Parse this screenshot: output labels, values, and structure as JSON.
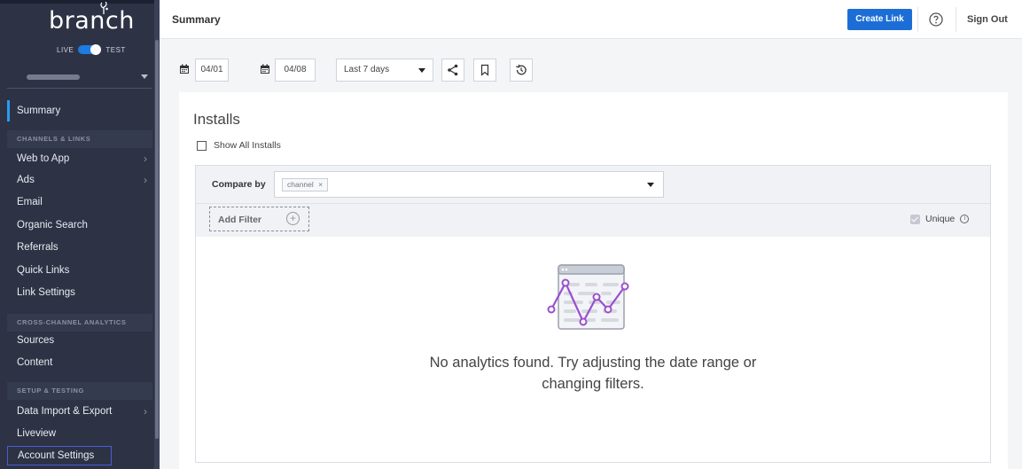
{
  "sidebar": {
    "logo": "branch",
    "env": {
      "live": "LIVE",
      "test": "TEST"
    },
    "summary": "Summary",
    "sections": {
      "channels": "CHANNELS & LINKS",
      "cross": "CROSS-CHANNEL ANALYTICS",
      "setup": "SETUP & TESTING"
    },
    "items": {
      "web_to_app": "Web to App",
      "ads": "Ads",
      "email": "Email",
      "organic_search": "Organic Search",
      "referrals": "Referrals",
      "quick_links": "Quick Links",
      "link_settings": "Link Settings",
      "sources": "Sources",
      "content": "Content",
      "data_import_export": "Data Import & Export",
      "liveview": "Liveview",
      "account_settings": "Account Settings"
    },
    "chevron": "›"
  },
  "header": {
    "title": "Summary",
    "create_link": "Create Link",
    "sign_out": "Sign Out"
  },
  "toolbar": {
    "start_date": "04/01",
    "end_date": "04/08",
    "range": "Last 7 days"
  },
  "main": {
    "heading": "Installs",
    "show_all": "Show All Installs",
    "compare_by": "Compare by",
    "compare_tag": "channel",
    "tag_remove": "×",
    "add_filter": "Add Filter",
    "add_plus": "+",
    "unique": "Unique",
    "info": "i",
    "empty_line1": "No analytics found. Try adjusting the date range or",
    "empty_line2": "changing filters."
  },
  "colors": {
    "sidebar_bg": "#2d3345",
    "accent": "#1c6ed6",
    "active_marker": "#2b9af3",
    "illustration": "#9b4fcf"
  }
}
